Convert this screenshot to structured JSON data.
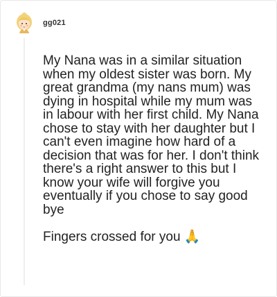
{
  "comment": {
    "username": "gg021",
    "avatar_icon": "blonde-girl-cartoon-avatar",
    "paragraphs": [
      "My Nana was in a similar situation when my oldest sister was born. My great grandma (my nans mum) was dying in hospital while my mum was in labour with her first child. My Nana chose to stay with her daughter but I can't even imagine how hard of a decision that was for her. I don't think there's a right answer to this but I know your wife will forgive you eventually if you chose to say good bye",
      "Fingers crossed for you"
    ],
    "closing_emoji": "🙏",
    "closing_emoji_icon": "praying-hands-icon"
  },
  "colors": {
    "border": "#e8e8e8",
    "thread_line": "#eeeeee",
    "text": "#222222",
    "username": "#333333",
    "emoji": "#e7a93b"
  }
}
